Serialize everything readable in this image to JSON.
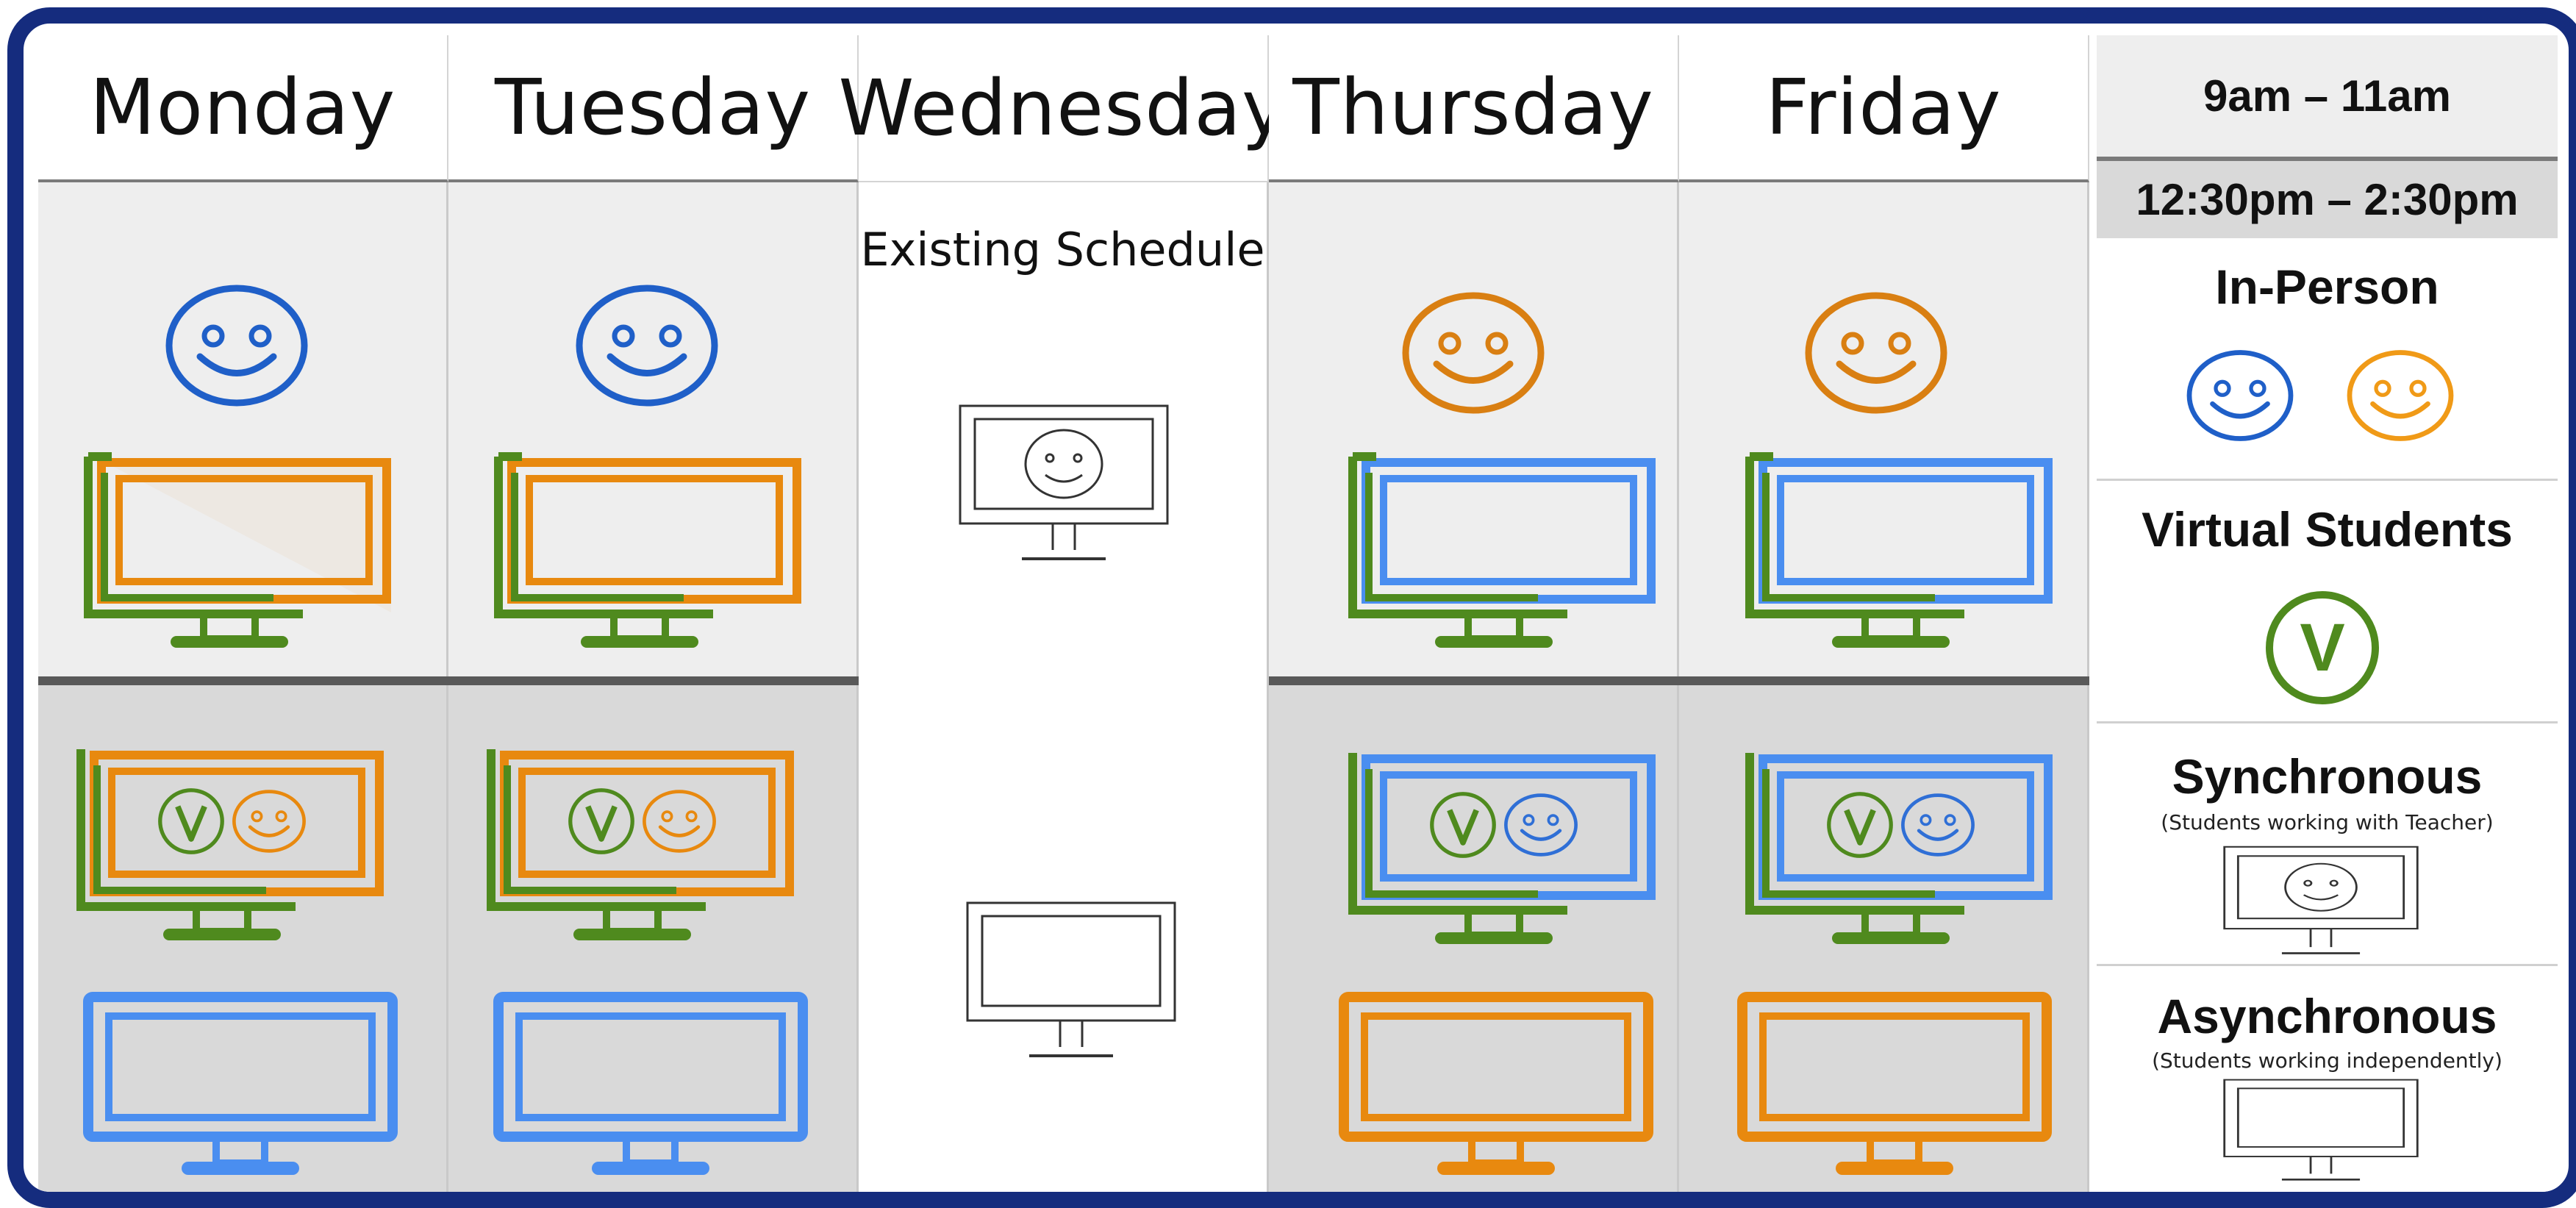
{
  "days": [
    "Monday",
    "Tuesday",
    "Wednesday",
    "Thursday",
    "Friday"
  ],
  "wednesday_label": "Existing Schedule",
  "legend": {
    "time_slots": [
      "9am – 11am",
      "12:30pm – 2:30pm"
    ],
    "in_person": {
      "title": "In-Person"
    },
    "virtual": {
      "title": "Virtual Students",
      "badge": "V"
    },
    "synchronous": {
      "title": "Synchronous",
      "subtitle": "(Students working with Teacher)"
    },
    "asynchronous": {
      "title": "Asynchronous",
      "subtitle": "(Students working independently)"
    }
  },
  "colors": {
    "frame": "#152c7e",
    "blue_group": "#2f6fd6",
    "orange_group": "#e8890f",
    "virtual_green": "#4f8a1e",
    "blue_screen": "#4a8ef0"
  },
  "schedule": {
    "Monday": {
      "morning": "blue in-person + virtual with orange",
      "afternoon": "virtual + orange synchronous, blue asynchronous"
    },
    "Tuesday": {
      "morning": "blue in-person + virtual with orange",
      "afternoon": "virtual + orange synchronous, blue asynchronous"
    },
    "Thursday": {
      "morning": "orange in-person + virtual with blue",
      "afternoon": "virtual + blue synchronous, orange asynchronous"
    },
    "Friday": {
      "morning": "orange in-person + virtual with blue",
      "afternoon": "virtual + blue synchronous, orange asynchronous"
    }
  }
}
